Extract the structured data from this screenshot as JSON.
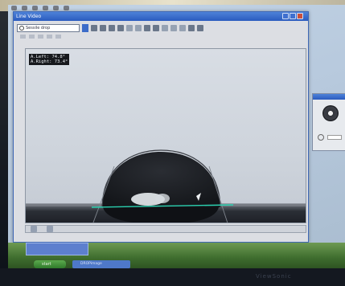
{
  "app": {
    "window_title": "Line Video",
    "mode_select_value": "Sessile drop",
    "readout_lines": [
      "A.Left: 74.8°",
      "A.Right: 73.4°"
    ]
  },
  "colors": {
    "baseline": "#2bd1b0",
    "fit_curve": "#3c3f46",
    "droplet": "#1a1d22"
  },
  "taskbar": {
    "start_label": "start",
    "task_label": "DROPimage"
  }
}
